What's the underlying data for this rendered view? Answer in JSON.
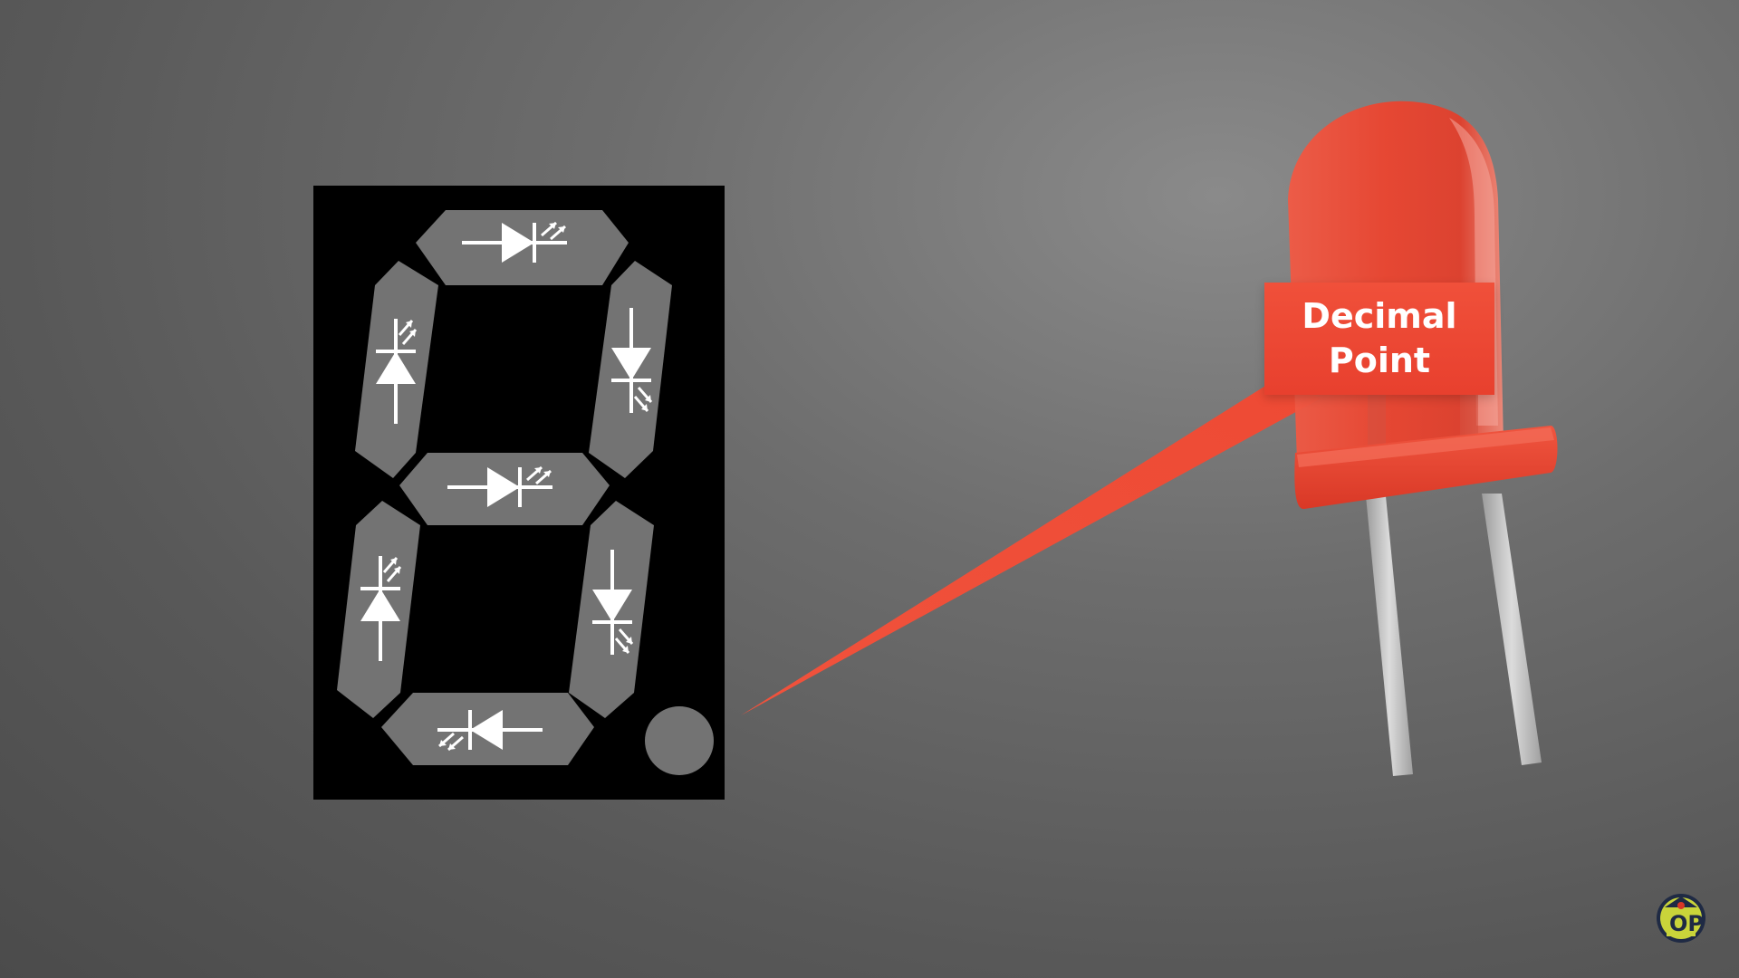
{
  "callout": {
    "line1": "Decimal",
    "line2": "Point"
  },
  "display": {
    "segments": [
      "a",
      "b",
      "c",
      "d",
      "e",
      "f",
      "g"
    ],
    "decimal_point": "dp"
  },
  "colors": {
    "background": "#6d6d6d",
    "display_body": "#000000",
    "segment_fill": "#727272",
    "symbol": "#ffffff",
    "led_red": "#e8402e",
    "led_leg": "#bdbdbd"
  },
  "icons": {
    "logo": "op-logo-icon",
    "diode": "led-diode-icon"
  }
}
